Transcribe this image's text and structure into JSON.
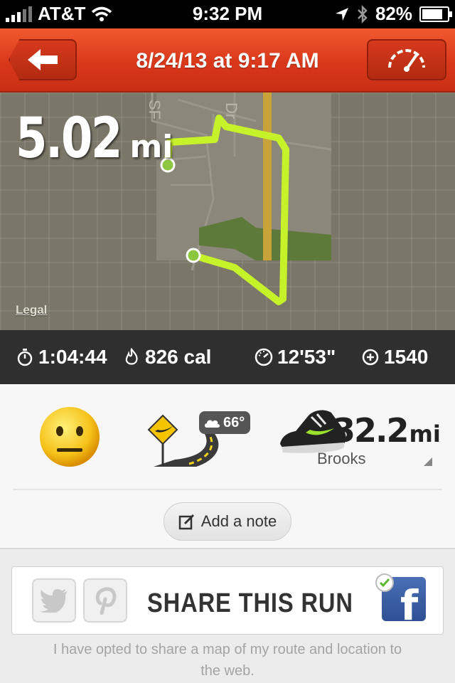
{
  "status_bar": {
    "carrier": "AT&T",
    "time": "9:32 PM",
    "battery": "82%",
    "battery_level": 0.82
  },
  "nav": {
    "title": "8/24/13 at 9:17 AM",
    "back_icon": "back-arrow-icon",
    "right_icon": "speedometer-icon"
  },
  "map": {
    "distance_value": "5.02",
    "distance_unit": "mi",
    "legal_label": "Legal",
    "route_color": "#c6f22a"
  },
  "stats": {
    "duration": "1:04:44",
    "calories": "826 cal",
    "pace": "12'53\"",
    "fuel": "1540"
  },
  "details": {
    "weather_temp": "66°",
    "shoe_miles_value": "32.2",
    "shoe_miles_unit": "mi",
    "shoe_name": "Brooks",
    "add_note_label": "Add a note"
  },
  "share": {
    "label": "SHARE THIS RUN",
    "note": "I have opted to share a map of my route and location to the web.",
    "facebook_letter": "f"
  },
  "colors": {
    "nav_red": "#d9371a",
    "stats_bg": "#2f2f2f",
    "facebook_blue": "#3b5998"
  }
}
